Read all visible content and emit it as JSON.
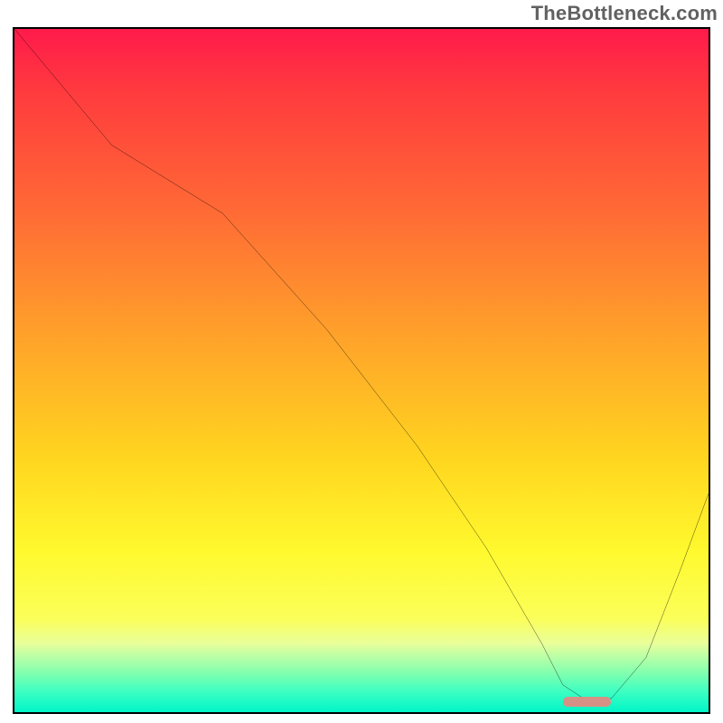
{
  "watermark": "TheBottleneck.com",
  "chart_data": {
    "type": "line",
    "title": "",
    "xlabel": "",
    "ylabel": "",
    "xlim": [
      0,
      100
    ],
    "ylim": [
      0,
      100
    ],
    "series": [
      {
        "name": "bottleneck-curve",
        "x": [
          0,
          14,
          30,
          45,
          58,
          68,
          76,
          79,
          82,
          86,
          91,
          96,
          100
        ],
        "y": [
          100,
          83,
          73,
          56,
          39,
          24,
          10,
          4,
          2,
          2,
          8,
          21,
          32
        ]
      }
    ],
    "marker": {
      "name": "optimal-range",
      "x_start": 79,
      "x_end": 86,
      "y": 1.5,
      "color": "#d69186"
    },
    "gradient_stops": [
      {
        "pos": 0.0,
        "color": "#ff1a4b"
      },
      {
        "pos": 0.3,
        "color": "#ff6b35"
      },
      {
        "pos": 0.5,
        "color": "#ffa22a"
      },
      {
        "pos": 0.7,
        "color": "#ffd61f"
      },
      {
        "pos": 0.88,
        "color": "#fff92e"
      },
      {
        "pos": 0.93,
        "color": "#e9ff9b"
      },
      {
        "pos": 0.97,
        "color": "#7cffb0"
      },
      {
        "pos": 1.0,
        "color": "#00f5c8"
      }
    ]
  }
}
